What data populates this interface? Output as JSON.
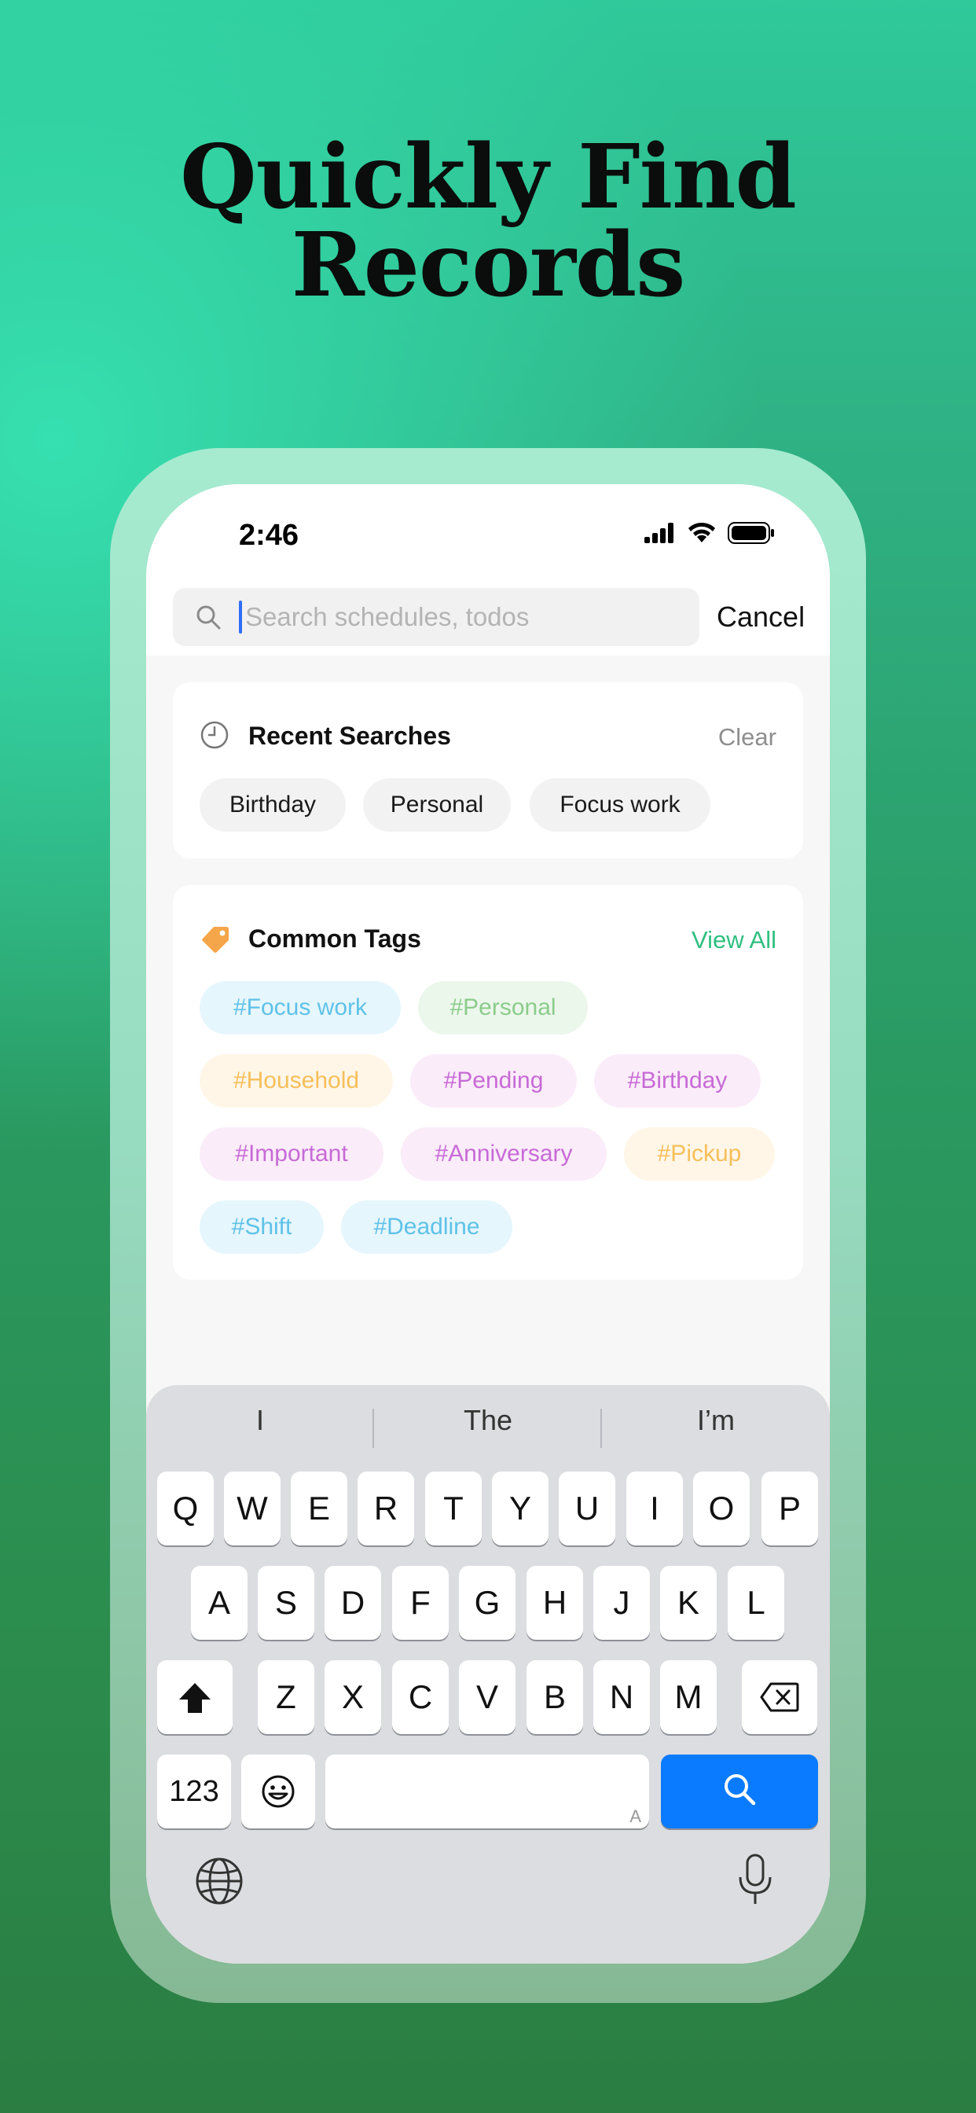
{
  "headline": "Quickly Find Records",
  "status_bar": {
    "time": "2:46"
  },
  "search": {
    "placeholder": "Search schedules, todos",
    "cancel_label": "Cancel"
  },
  "recent": {
    "title": "Recent Searches",
    "clear_label": "Clear",
    "items": [
      "Birthday",
      "Personal",
      "Focus work"
    ]
  },
  "tags": {
    "title": "Common Tags",
    "view_all_label": "View All",
    "items": [
      "#Focus work",
      "#Personal",
      "#Household",
      "#Pending",
      "#Birthday",
      "#Important",
      "#Anniversary",
      "#Pickup",
      "#Shift",
      "#Deadline"
    ]
  },
  "keyboard": {
    "predictions": [
      "I",
      "The",
      "I’m"
    ],
    "row1": [
      "Q",
      "W",
      "E",
      "R",
      "T",
      "Y",
      "U",
      "I",
      "O",
      "P"
    ],
    "row2": [
      "A",
      "S",
      "D",
      "F",
      "G",
      "H",
      "J",
      "K",
      "L"
    ],
    "row3": [
      "Z",
      "X",
      "C",
      "V",
      "B",
      "N",
      "M"
    ],
    "numbers_label": "123",
    "space_hint": "A"
  },
  "colors": {
    "accent": "#2fbf7f",
    "search_key": "#0a7bff",
    "tag_icon": "#f5a54a"
  },
  "icons": [
    "search-icon",
    "clock-icon",
    "tag-icon",
    "signal-icon",
    "wifi-icon",
    "battery-icon",
    "shift-icon",
    "delete-icon",
    "emoji-icon",
    "globe-icon",
    "microphone-icon"
  ]
}
